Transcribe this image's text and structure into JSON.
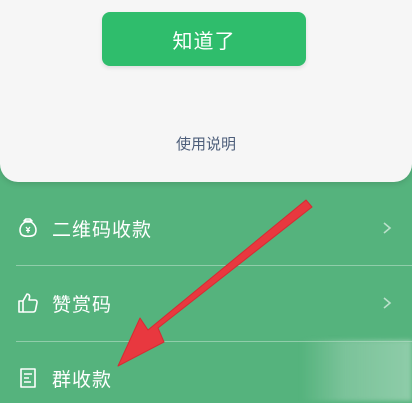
{
  "dialog": {
    "ok_button": "知道了",
    "help_link": "使用说明"
  },
  "menu": {
    "items": [
      {
        "label": "二维码收款",
        "icon": "money-bag-icon",
        "chevron": true
      },
      {
        "label": "赞赏码",
        "icon": "thumbs-up-icon",
        "chevron": true
      },
      {
        "label": "群收款",
        "icon": "receipt-icon",
        "chevron": false
      }
    ]
  },
  "colors": {
    "background": "#55b37d",
    "primary_button": "#2fbd6c",
    "arrow": "#e8383f"
  }
}
